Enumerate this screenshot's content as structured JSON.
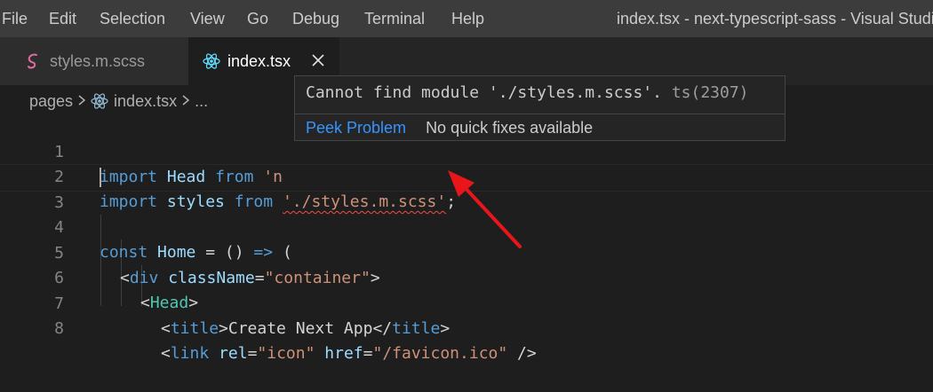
{
  "menu": {
    "items": [
      "File",
      "Edit",
      "Selection",
      "View",
      "Go",
      "Debug",
      "Terminal",
      "Help"
    ],
    "window_title": "index.tsx - next-typescript-sass - Visual Studio"
  },
  "tabs": [
    {
      "label": "styles.m.scss",
      "icon": "scss-file-icon",
      "active": false
    },
    {
      "label": "index.tsx",
      "icon": "react-file-icon",
      "active": true
    }
  ],
  "breadcrumb": {
    "folder": "pages",
    "file": "index.tsx",
    "more": "..."
  },
  "editor": {
    "line_numbers": [
      "1",
      "2",
      "3",
      "4",
      "5",
      "6",
      "7",
      "8"
    ],
    "lines": {
      "l1": {
        "kw": "import",
        "name": "Head",
        "from": "from",
        "str": "'n"
      },
      "l2": {
        "kw": "import",
        "name": "styles",
        "from": "from",
        "str": "'./styles.m.scss'",
        "semi": ";"
      },
      "l4": {
        "kw": "const",
        "name": "Home",
        "rest1": " = () ",
        "arrow": "=>",
        "rest2": " ("
      },
      "l5": {
        "open": "<",
        "tag": "div",
        "attr": "className",
        "eq": "=",
        "str": "\"container\"",
        "close": ">"
      },
      "l6": {
        "open": "<",
        "tag": "Head",
        "close": ">"
      },
      "l7": {
        "open": "<",
        "tag": "title",
        "close": ">",
        "text": "Create Next App",
        "open2": "</",
        "tag2": "title",
        "close2": ">"
      },
      "l8": {
        "open": "<",
        "tag": "link",
        "attr1": "rel",
        "eq1": "=",
        "str1": "\"icon\"",
        "attr2": "href",
        "eq2": "=",
        "str2": "\"/favicon.ico\"",
        "end": " />"
      }
    }
  },
  "hover": {
    "message": "Cannot find module './styles.m.scss'.",
    "code": "ts(2307)",
    "peek_label": "Peek Problem",
    "no_fix_label": "No quick fixes available"
  },
  "colors": {
    "error_squiggle": "#f14c4c",
    "annotation_arrow": "#e8161b",
    "link": "#3794ff"
  }
}
